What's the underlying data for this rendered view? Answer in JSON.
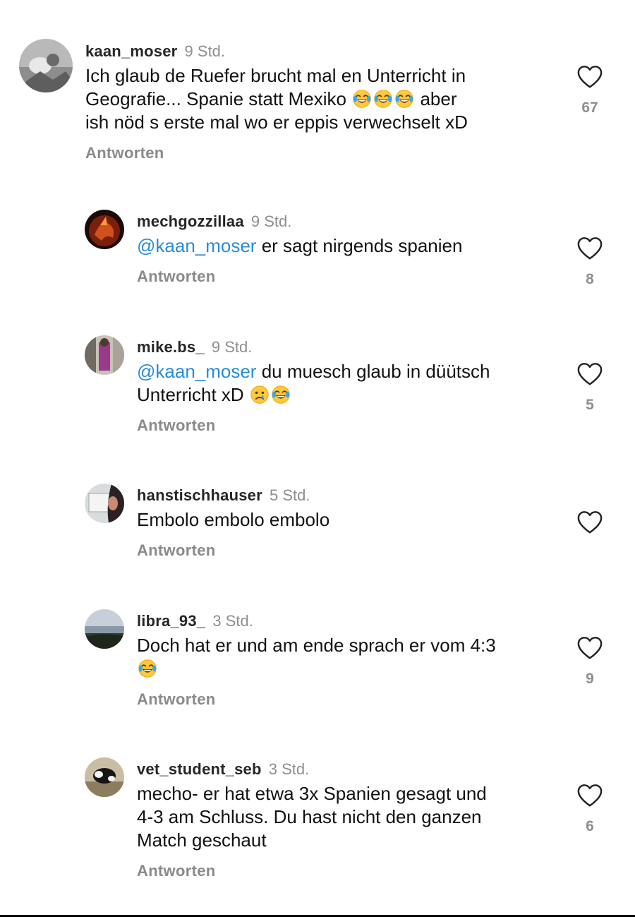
{
  "comments": [
    {
      "username": "kaan_moser",
      "time": "9 Std.",
      "line1": "Ich glaub de Ruefer brucht mal en Unterricht in",
      "line2_start": "Geografie... Spanie statt Mexiko",
      "line2_end": "aber",
      "line3": "ish nöd s erste mal wo er eppis verwechselt xD",
      "reply_label": "Antworten",
      "likes": "67"
    },
    {
      "username": "mechgozzillaa",
      "time": "9 Std.",
      "mention": "@kaan_moser",
      "text": " er sagt nirgends spanien",
      "reply_label": "Antworten",
      "likes": "8"
    },
    {
      "username": "mike.bs_",
      "time": "9 Std.",
      "mention": "@kaan_moser",
      "line1": " du muesch glaub in düütsch",
      "line2": "Unterricht xD",
      "reply_label": "Antworten",
      "likes": "5"
    },
    {
      "username": "hanstischhauser",
      "time": "5 Std.",
      "text": "Embolo embolo embolo",
      "reply_label": "Antworten",
      "likes": ""
    },
    {
      "username": "libra_93_",
      "time": "3 Std.",
      "line1": "Doch hat er und am ende sprach er vom 4:3",
      "reply_label": "Antworten",
      "likes": "9"
    },
    {
      "username": "vet_student_seb",
      "time": "3 Std.",
      "line1": "mecho- er hat etwa 3x Spanien gesagt und",
      "line2": "4-3 am Schluss. Du hast nicht den ganzen",
      "line3": "Match geschaut",
      "reply_label": "Antworten",
      "likes": "6"
    }
  ],
  "icons": {
    "like": "heart-outline-icon",
    "emoji_laugh": "face-with-tears-of-joy-icon",
    "emoji_sad": "crying-face-icon"
  },
  "colors": {
    "mention": "#2a8bd8",
    "muted": "#8e8e8e"
  }
}
